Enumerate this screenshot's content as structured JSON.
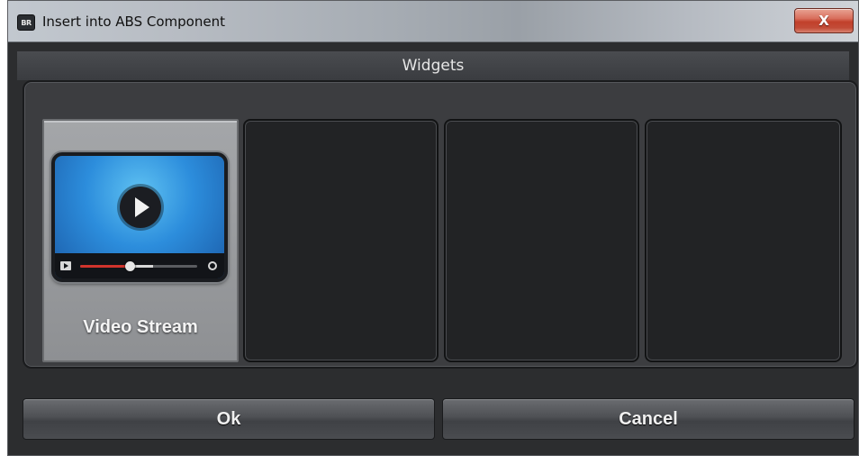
{
  "window": {
    "title": "Insert into ABS Component",
    "icon_text": "BR",
    "close_label": "X"
  },
  "section": {
    "title": "Widgets"
  },
  "widgets": [
    {
      "label": "Video Stream",
      "icon": "video-player-icon",
      "selected": true,
      "playback_progress": 0.42,
      "buffer_progress": 0.62
    },
    {
      "label": "",
      "empty": true
    },
    {
      "label": "",
      "empty": true
    },
    {
      "label": "",
      "empty": true
    }
  ],
  "buttons": {
    "ok_label": "Ok",
    "cancel_label": "Cancel"
  }
}
